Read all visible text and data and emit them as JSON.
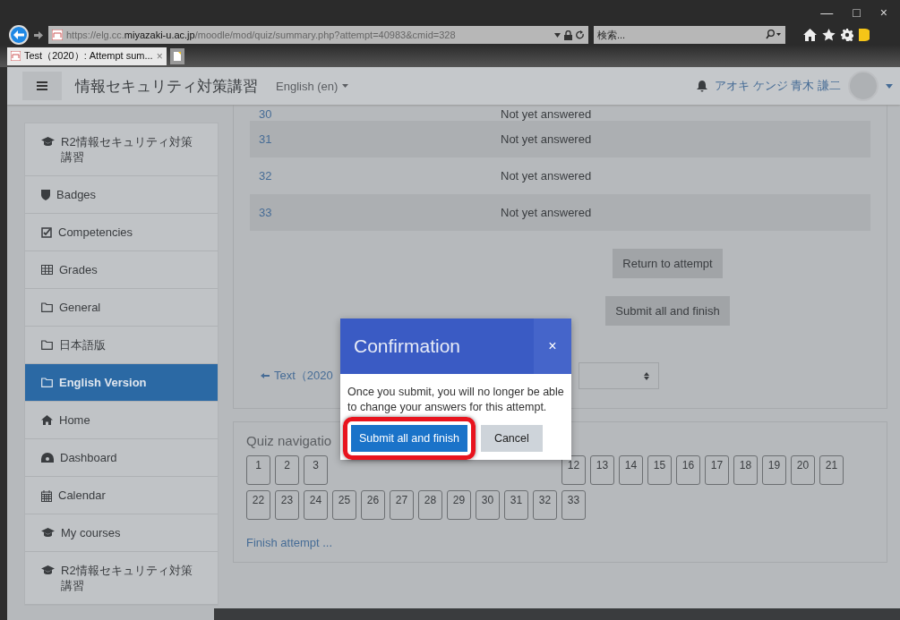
{
  "browser": {
    "window_controls": [
      "—",
      "□",
      "×"
    ],
    "address": "https://elg.cc.**miyazaki-u.ac.jp**/moodle/mod/quiz/summary.php?attempt=40983&cmid=328",
    "search": {
      "placeholder": "検索..."
    },
    "tabs": [
      {
        "title": "Test（2020）: Attempt sum...",
        "selected": true,
        "close": "×"
      }
    ]
  },
  "navbar": {
    "site_name": "情報セキュリティ対策講習",
    "language": "English (en)",
    "user_name": "アオキ ケンジ 青木 謙二"
  },
  "sidebar": {
    "items": [
      {
        "label": "R2情報セキュリティ対策講習",
        "selected": false
      },
      {
        "label": "Badges",
        "selected": false
      },
      {
        "label": "Competencies",
        "selected": false
      },
      {
        "label": "Grades",
        "selected": false
      },
      {
        "label": "General",
        "selected": false
      },
      {
        "label": "日本語版",
        "selected": false
      },
      {
        "label": "English Version",
        "selected": true
      },
      {
        "label": "Home",
        "selected": false
      },
      {
        "label": "Dashboard",
        "selected": false
      },
      {
        "label": "Calendar",
        "selected": false
      },
      {
        "label": "My courses",
        "selected": false
      },
      {
        "label": "R2情報セキュリティ対策講習",
        "selected": false
      }
    ]
  },
  "summary": {
    "rows": [
      {
        "number": "30",
        "status": "Not yet answered"
      },
      {
        "number": "31",
        "status": "Not yet answered"
      },
      {
        "number": "32",
        "status": "Not yet answered"
      },
      {
        "number": "33",
        "status": "Not yet answered"
      }
    ],
    "buttons": [
      "Return to attempt",
      "Submit all and finish"
    ],
    "previous_link": "Text（2020"
  },
  "quiz_navigation": {
    "title": "Quiz navigatio",
    "row_1_before": [
      "1",
      "2",
      "3"
    ],
    "row_1_after": [
      "12",
      "13",
      "14",
      "15",
      "16",
      "17",
      "18",
      "19",
      "20",
      "21"
    ],
    "row_2": [
      "22",
      "23",
      "24",
      "25",
      "26",
      "27",
      "28",
      "29",
      "30",
      "31",
      "32",
      "33"
    ],
    "finish_link": "Finish attempt ..."
  },
  "modal": {
    "title": "Confirmation",
    "close": "×",
    "message": "Once you submit, you will no longer be able to change your answers for this attempt.",
    "buttons": [
      {
        "label": "Submit all and finish",
        "kind": "primary",
        "highlighted": true
      },
      {
        "label": "Cancel",
        "kind": "secondary",
        "highlighted": false
      }
    ]
  }
}
